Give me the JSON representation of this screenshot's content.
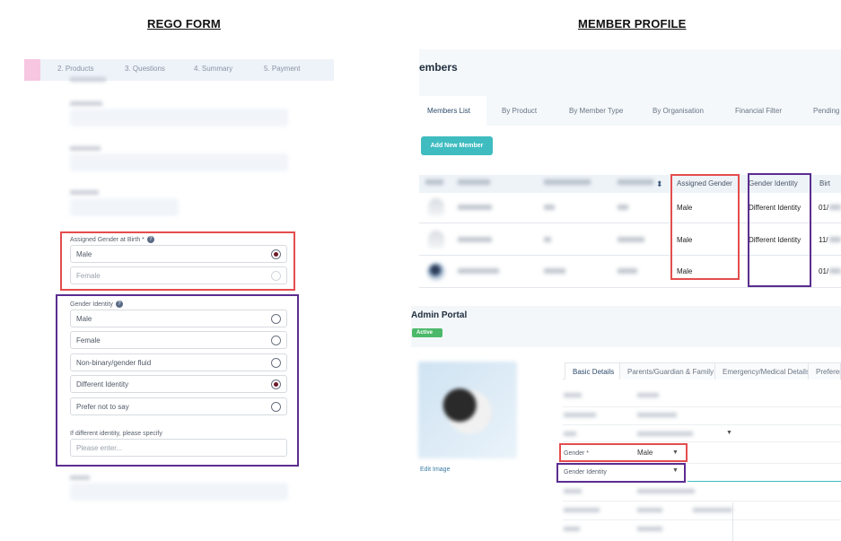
{
  "headings": {
    "left": "REGO FORM",
    "right": "MEMBER PROFILE"
  },
  "rego_form": {
    "steps": [
      "2. Products",
      "3. Questions",
      "4. Summary",
      "5. Payment"
    ],
    "assigned_gender": {
      "label": "Assigned Gender at Birth *",
      "options": [
        {
          "label": "Male",
          "selected": true
        },
        {
          "label": "Female",
          "selected": false
        }
      ]
    },
    "gender_identity": {
      "label": "Gender Identity",
      "options": [
        {
          "label": "Male",
          "selected": false
        },
        {
          "label": "Female",
          "selected": false
        },
        {
          "label": "Non-binary/gender fluid",
          "selected": false
        },
        {
          "label": "Different Identity",
          "selected": true
        },
        {
          "label": "Prefer not to say",
          "selected": false
        }
      ],
      "specify_label": "If different identity, please specify",
      "specify_placeholder": "Please enter..."
    }
  },
  "member_profile": {
    "title": "embers",
    "tabs": [
      "Members List",
      "By Product",
      "By Member Type",
      "By Organisation",
      "Financial Filter",
      "Pending"
    ],
    "add_button": "Add New Member",
    "columns": {
      "assigned_gender": "Assigned Gender",
      "gender_identity": "Gender Identity",
      "birth": "Birt"
    },
    "rows": [
      {
        "assigned_gender": "Male",
        "gender_identity": "Different Identity",
        "birth": "01/"
      },
      {
        "assigned_gender": "Male",
        "gender_identity": "Different Identity",
        "birth": "11/"
      },
      {
        "assigned_gender": "Male",
        "gender_identity": "",
        "birth": "01/"
      }
    ],
    "admin_portal": {
      "title": "Admin Portal",
      "status": "Active",
      "edit_image": "Edit Image",
      "tabs": [
        "Basic Details",
        "Parents/Guardian & Family",
        "Emergency/Medical Details",
        "Preferen"
      ],
      "gender_label": "Gender *",
      "gender_value": "Male",
      "gender_identity_label": "Gender Identity"
    }
  },
  "colors": {
    "highlight_red": "#e44d4d",
    "highlight_purple": "#5b2d91",
    "accent_teal": "#3fbcc0",
    "status_green": "#4cb96a"
  }
}
